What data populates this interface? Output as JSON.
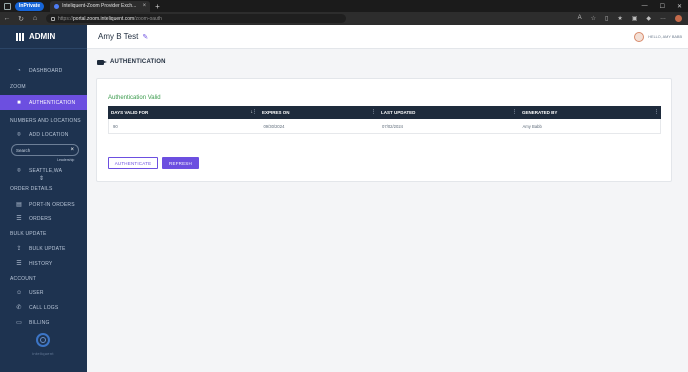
{
  "browser": {
    "private_label": "InPrivate",
    "tab_title": "Inteliquent-Zoom Provider Exch...",
    "url_prefix": "https://",
    "url_host": "portal.zoom.inteliquent.com",
    "url_path": "/zoom-oauth"
  },
  "sidebar": {
    "brand": "ADMIN",
    "dashboard": "DASHBOARD",
    "zoom_section": "ZOOM",
    "authentication": "AUTHENTICATION",
    "numbers_section": "NUMBERS AND LOCATIONS",
    "add_location": "ADD LOCATION",
    "search_placeholder": "Search",
    "leadership": "Leadership",
    "seattle": "SEATTLE,WA",
    "order_section": "ORDER DETAILS",
    "port_in": "PORT-IN ORDERS",
    "orders": "ORDERS",
    "bulk_section": "BULK UPDATE",
    "bulk_update": "BULK UPDATE",
    "history": "HISTORY",
    "account_section": "ACCOUNT",
    "user": "USER",
    "call_logs": "CALL LOGS",
    "billing": "BILLING",
    "logo_text": "inteliquent"
  },
  "header": {
    "user_name": "Amy B Test",
    "greeting": "HELLO, AMY BABB"
  },
  "page": {
    "title": "AUTHENTICATION",
    "status": "Authentication Valid",
    "columns": [
      "DAYS VALID FOR",
      "EXPIRES ON",
      "LAST UPDATED",
      "GENERATED BY"
    ],
    "rows": [
      [
        "90",
        "09/30/2024",
        "07/02/2024",
        "Amy Babb"
      ]
    ],
    "authenticate_label": "AUTHENTICATE",
    "refresh_label": "REFRESH"
  }
}
